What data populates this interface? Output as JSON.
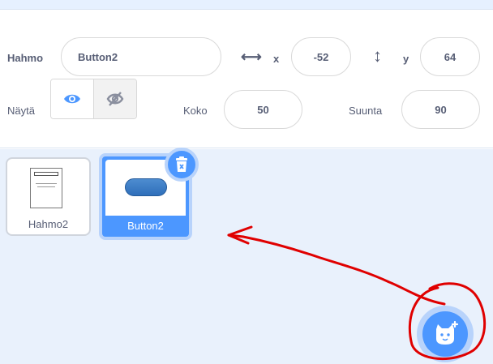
{
  "sprite_info": {
    "name_label": "Hahmo",
    "name_value": "Button2",
    "x_label": "x",
    "x_value": "-52",
    "y_label": "y",
    "y_value": "64",
    "show_label": "Näytä",
    "size_label": "Koko",
    "size_value": "50",
    "direction_label": "Suunta",
    "direction_value": "90",
    "visible": true
  },
  "sprites": [
    {
      "name": "Hahmo2",
      "selected": false,
      "icon": "document-thumbnail"
    },
    {
      "name": "Button2",
      "selected": true,
      "icon": "button-thumbnail"
    }
  ],
  "delete_button": {
    "icon": "trash-icon"
  },
  "add_sprite_button": {
    "icon": "cat-plus-icon"
  },
  "annotation": {
    "color": "#e00000"
  },
  "colors": {
    "accent": "#4c97ff",
    "accent_light": "#b8d3fb",
    "panel_bg": "#e9f1fc",
    "text": "#575e75"
  }
}
